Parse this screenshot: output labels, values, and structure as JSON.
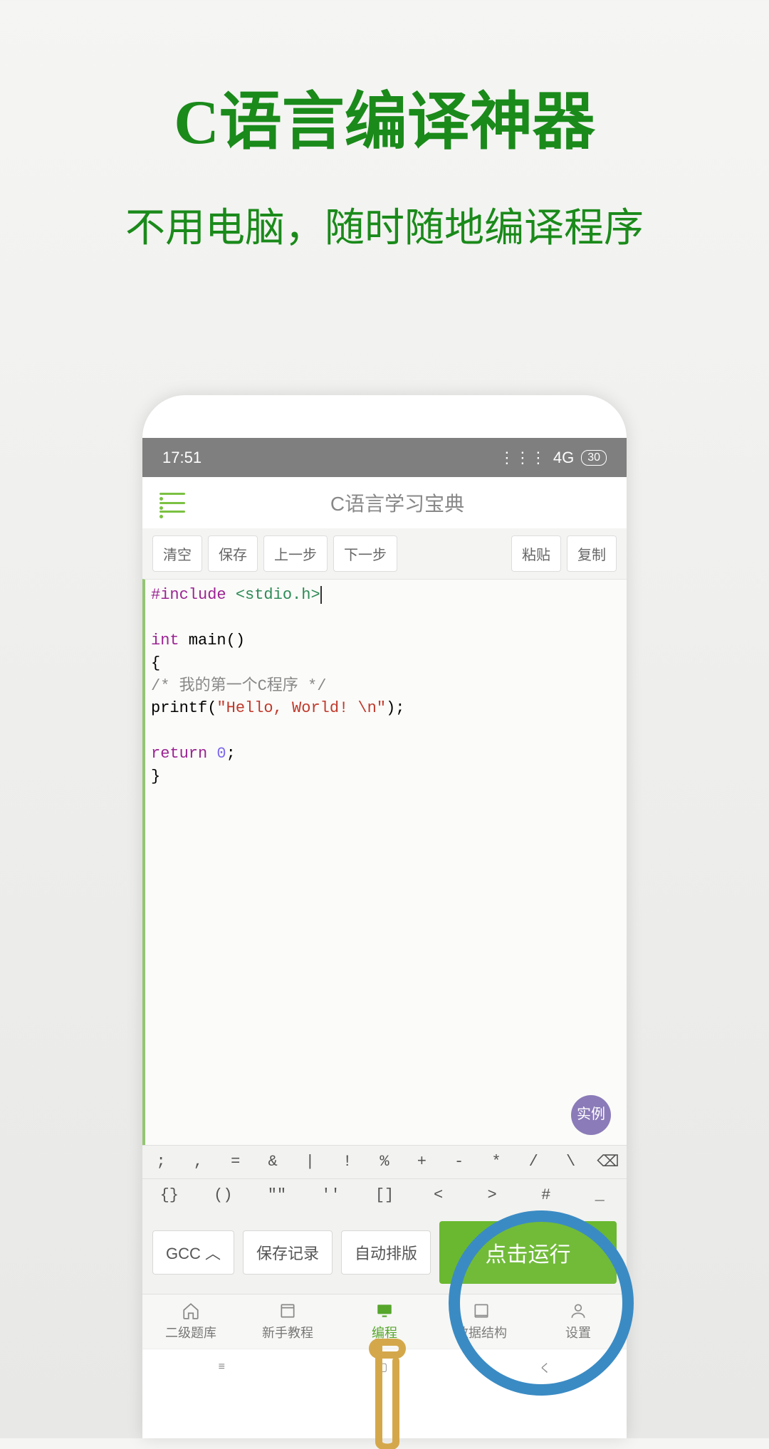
{
  "promo": {
    "title": "C语言编译神器",
    "subtitle": "不用电脑，随时随地编译程序"
  },
  "statusbar": {
    "time": "17:51",
    "network": "4G",
    "battery": "30"
  },
  "header": {
    "title": "C语言学习宝典"
  },
  "toolbar": {
    "clear": "清空",
    "save": "保存",
    "prev": "上一步",
    "next": "下一步",
    "paste": "粘贴",
    "copy": "复制"
  },
  "code": {
    "line1_kw": "#include",
    "line1_inc": " <stdio.h>",
    "line2_kw": "int",
    "line2_rest": " main()",
    "line3": "{",
    "line4_cmt": "   /* 我的第一个C程序 */",
    "line5_a": "   printf(",
    "line5_str": "\"Hello, World! \\n\"",
    "line5_b": ");",
    "line6_kw": "   return ",
    "line6_num": "0",
    "line6_b": ";",
    "line7": "}"
  },
  "example_badge": "实例",
  "symbols_row1": [
    ";",
    ",",
    "=",
    "&",
    "|",
    "!",
    "%",
    "+",
    "-",
    "*",
    "/",
    "\\",
    "⌫"
  ],
  "symbols_row2": [
    "{}",
    "()",
    "\"\"",
    "''",
    "[]",
    "<",
    ">",
    "#",
    "_"
  ],
  "actions": {
    "gcc": "GCC",
    "save_record": "保存记录",
    "auto_format": "自动排版",
    "run": "点击运行"
  },
  "nav": {
    "exam": "二级题库",
    "tutorial": "新手教程",
    "code": "编程",
    "data": "数据结构",
    "settings": "设置"
  }
}
